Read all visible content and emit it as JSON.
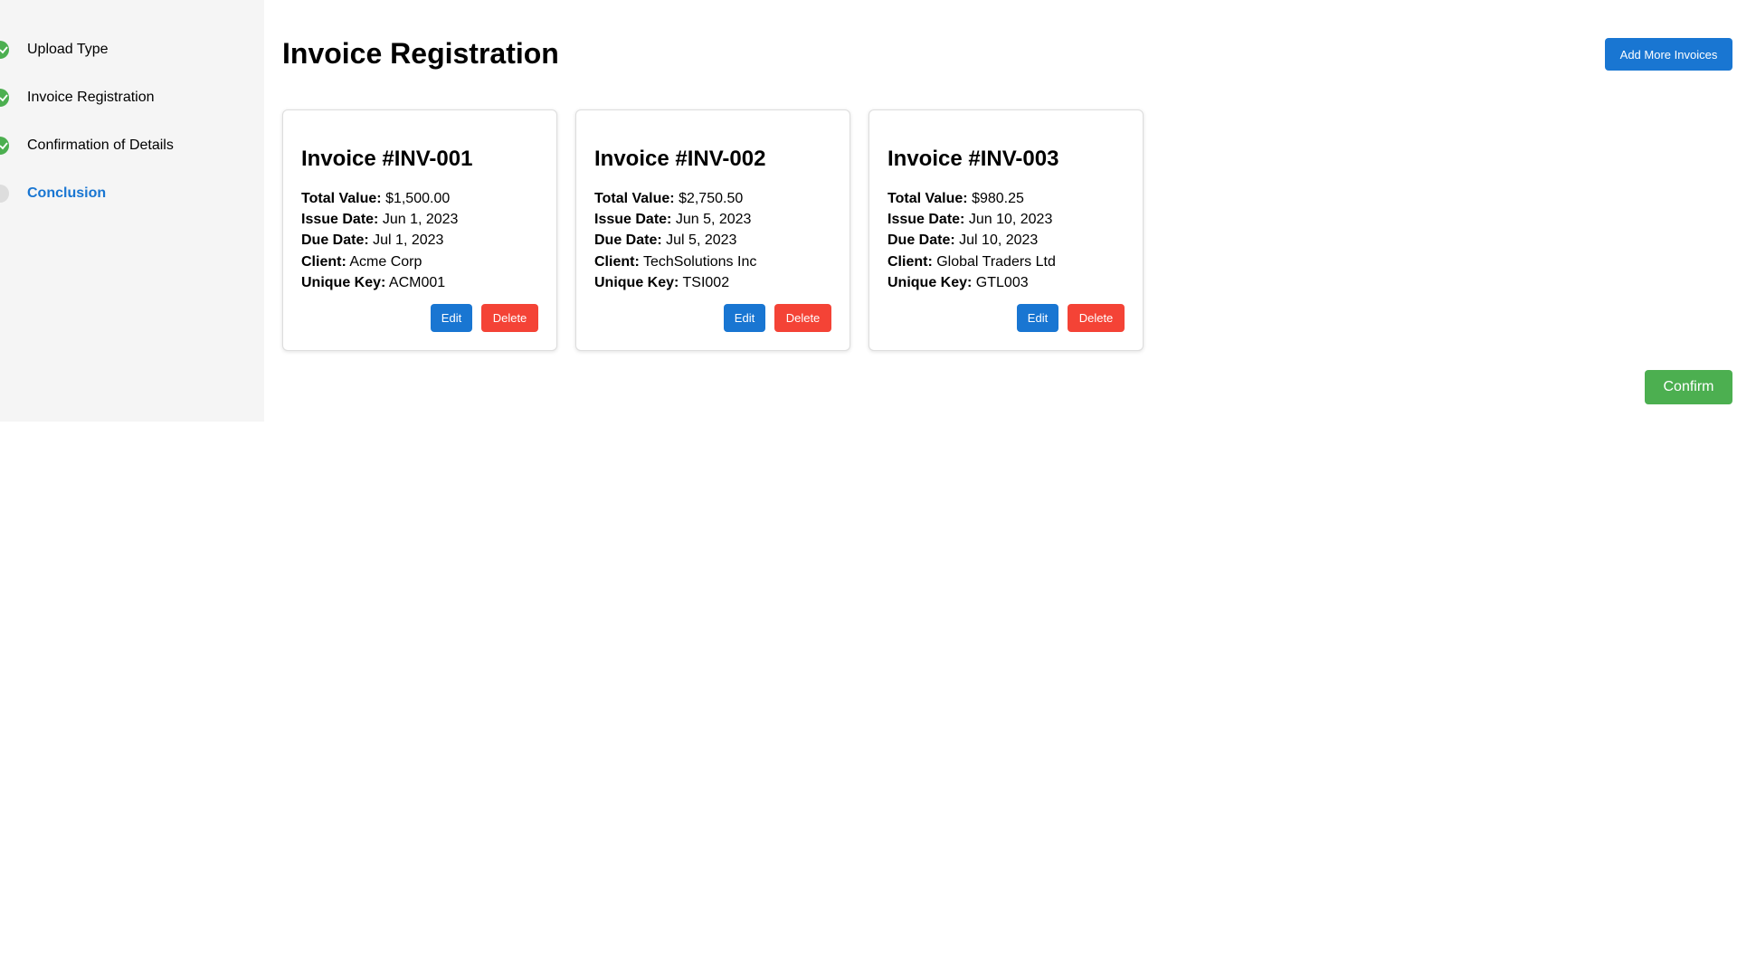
{
  "sidebar": {
    "steps": [
      {
        "label": "Upload Type",
        "status": "done",
        "icon": "check-icon"
      },
      {
        "label": "Invoice Registration",
        "status": "done",
        "icon": "check-icon"
      },
      {
        "label": "Confirmation of Details",
        "status": "done",
        "icon": "check-icon"
      },
      {
        "label": "Conclusion",
        "status": "pending",
        "icon": "circle-icon"
      }
    ]
  },
  "header": {
    "title": "Invoice Registration",
    "add_more_label": "Add More Invoices"
  },
  "field_labels": {
    "total_value": "Total Value:",
    "issue_date": "Issue Date:",
    "due_date": "Due Date:",
    "client": "Client:",
    "unique_key": "Unique Key:"
  },
  "actions": {
    "edit_label": "Edit",
    "delete_label": "Delete",
    "confirm_label": "Confirm"
  },
  "invoices": [
    {
      "title": "Invoice #INV-001",
      "total_value": "$1,500.00",
      "issue_date": "Jun 1, 2023",
      "due_date": "Jul 1, 2023",
      "client": "Acme Corp",
      "unique_key": "ACM001"
    },
    {
      "title": "Invoice #INV-002",
      "total_value": "$2,750.50",
      "issue_date": "Jun 5, 2023",
      "due_date": "Jul 5, 2023",
      "client": "TechSolutions Inc",
      "unique_key": "TSI002"
    },
    {
      "title": "Invoice #INV-003",
      "total_value": "$980.25",
      "issue_date": "Jun 10, 2023",
      "due_date": "Jul 10, 2023",
      "client": "Global Traders Ltd",
      "unique_key": "GTL003"
    }
  ],
  "colors": {
    "primary": "#1976d2",
    "danger": "#f44336",
    "success": "#4caf50",
    "sidebar_bg": "#f5f5f5"
  }
}
